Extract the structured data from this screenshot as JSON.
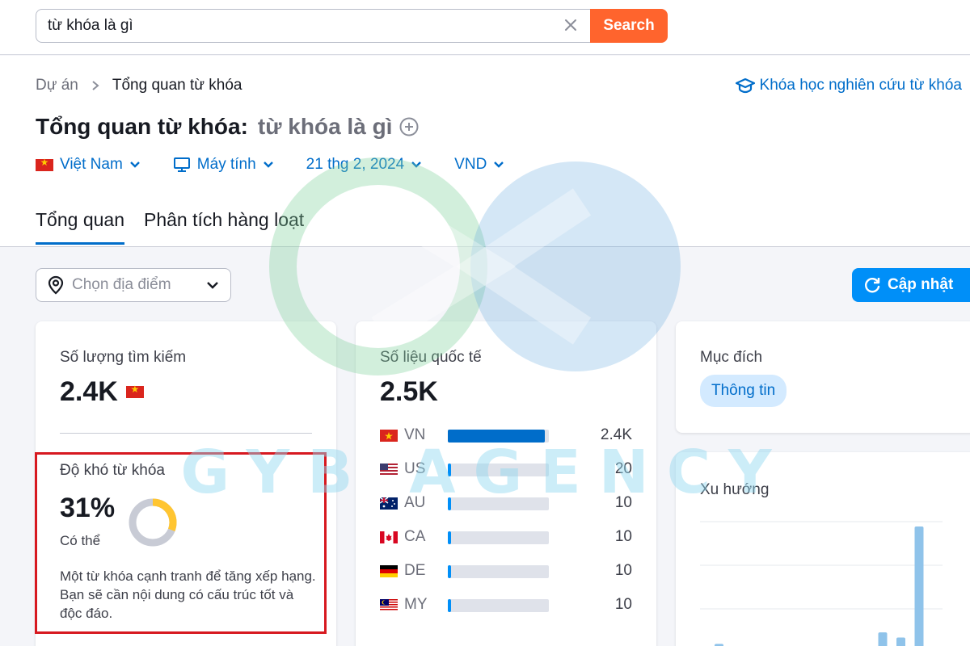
{
  "search": {
    "value": "từ khóa là gì",
    "button_label": "Search"
  },
  "breadcrumb": {
    "root": "Dự án",
    "current": "Tổng quan từ khóa"
  },
  "course_link": "Khóa học nghiên cứu từ khóa",
  "title": {
    "prefix": "Tổng quan từ khóa:",
    "keyword": "từ khóa là gì"
  },
  "filters": {
    "country": "Việt Nam",
    "device": "Máy tính",
    "date": "21 thg 2, 2024",
    "currency": "VND"
  },
  "tabs": [
    {
      "label": "Tổng quan",
      "active": true
    },
    {
      "label": "Phân tích hàng loạt",
      "active": false
    }
  ],
  "location_select": {
    "placeholder": "Chọn địa điểm"
  },
  "update_button": "Cập nhật",
  "volume": {
    "label": "Số lượng tìm kiếm",
    "value": "2.4K"
  },
  "keyword_difficulty": {
    "label": "Độ khó từ khóa",
    "value": "31%",
    "percent": 31,
    "level": "Có thể",
    "description": "Một từ khóa cạnh tranh để tăng xếp hạng. Bạn sẽ cần nội dung có cấu trúc tốt và độc đáo."
  },
  "global": {
    "label": "Số liệu quốc tế",
    "value": "2.5K",
    "countries": [
      {
        "code": "VN",
        "value": "2.4K",
        "share": 0.96
      },
      {
        "code": "US",
        "value": "20",
        "share": 0.02
      },
      {
        "code": "AU",
        "value": "10",
        "share": 0.02
      },
      {
        "code": "CA",
        "value": "10",
        "share": 0.02
      },
      {
        "code": "DE",
        "value": "10",
        "share": 0.02
      },
      {
        "code": "MY",
        "value": "10",
        "share": 0.02
      }
    ]
  },
  "intent": {
    "label": "Mục đích",
    "badge": "Thông tin"
  },
  "trend": {
    "label": "Xu hướng",
    "values": [
      0.08,
      0.03,
      0.03,
      0.03,
      0.03,
      0,
      0,
      0,
      0.05,
      0.17,
      0.13,
      1.0
    ]
  },
  "watermark_text": "GYB AGENCY",
  "colors": {
    "accent": "#006dca",
    "search_button": "#ff642d",
    "kd_ring": "#ffc531",
    "highlight_box": "#d71920",
    "update_button": "#008ff8"
  }
}
